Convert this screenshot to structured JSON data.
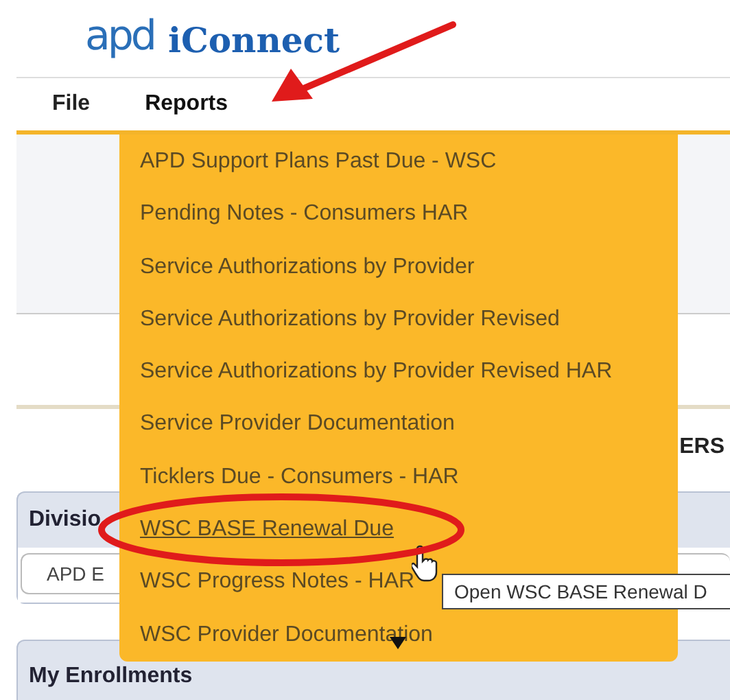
{
  "logo": {
    "mark": "apd",
    "name": "iConnect"
  },
  "menubar": [
    {
      "label": "File",
      "open": false
    },
    {
      "label": "Reports",
      "open": true
    }
  ],
  "reports_menu": [
    {
      "label": "APD Support Plans Past Due - WSC",
      "hovered": false
    },
    {
      "label": "Pending Notes - Consumers HAR",
      "hovered": false
    },
    {
      "label": "Service Authorizations by Provider",
      "hovered": false
    },
    {
      "label": "Service Authorizations by Provider Revised",
      "hovered": false
    },
    {
      "label": "Service Authorizations by Provider Revised HAR",
      "hovered": false
    },
    {
      "label": "Service Provider Documentation",
      "hovered": false
    },
    {
      "label": "Ticklers Due - Consumers - HAR",
      "hovered": false
    },
    {
      "label": "WSC BASE Renewal Due",
      "hovered": true
    },
    {
      "label": "WSC Progress Notes - HAR",
      "hovered": false
    },
    {
      "label": "WSC Provider Documentation",
      "hovered": false
    }
  ],
  "tooltip": "Open WSC BASE Renewal D",
  "tab_partial": "ERS",
  "division_panel": {
    "title": "Divisio",
    "field": "APD E"
  },
  "enrollments_panel": {
    "title": "My Enrollments"
  }
}
